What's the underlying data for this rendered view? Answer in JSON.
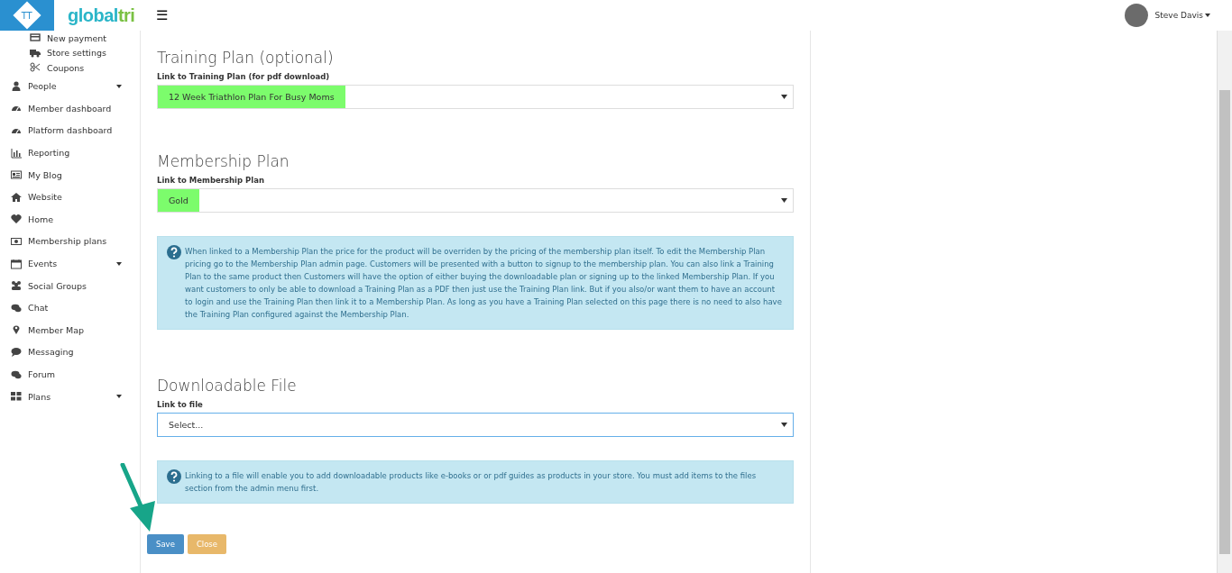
{
  "header": {
    "logo_mark": "TT",
    "logo_word": "global",
    "logo_word_accent": "tri",
    "menu_glyph": "☰",
    "user": {
      "name": "Steve Davis"
    }
  },
  "sidebar": {
    "sub_items": [
      {
        "label": "New payment"
      },
      {
        "label": "Store settings"
      },
      {
        "label": "Coupons"
      }
    ],
    "items": [
      {
        "label": "People",
        "has_submenu": true
      },
      {
        "label": "Member dashboard",
        "has_submenu": false
      },
      {
        "label": "Platform dashboard",
        "has_submenu": false
      },
      {
        "label": "Reporting",
        "has_submenu": false
      },
      {
        "label": "My Blog",
        "has_submenu": false
      },
      {
        "label": "Website",
        "has_submenu": false
      },
      {
        "label": "Home",
        "has_submenu": false
      },
      {
        "label": "Membership plans",
        "has_submenu": false
      },
      {
        "label": "Events",
        "has_submenu": true
      },
      {
        "label": "Social Groups",
        "has_submenu": false
      },
      {
        "label": "Chat",
        "has_submenu": false
      },
      {
        "label": "Member Map",
        "has_submenu": false
      },
      {
        "label": "Messaging",
        "has_submenu": false
      },
      {
        "label": "Forum",
        "has_submenu": false
      },
      {
        "label": "Plans",
        "has_submenu": true
      }
    ]
  },
  "sections": [
    {
      "title": "Training Plan (optional)",
      "label": "Link to Training Plan (for pdf download)",
      "value": "12 Week Triathlon Plan For Busy Moms",
      "highlighted": true,
      "focused": false
    },
    {
      "title": "Membership Plan",
      "label": "Link to Membership Plan",
      "value": "Gold",
      "highlighted": true,
      "focused": false,
      "note": "When linked to a Membership Plan the price for the product will be overriden by the pricing of the membership plan itself. To edit the Membership Plan pricing go to the Membership Plan admin page. Customers will be presented with a button to signup to the membership plan. You can also link a Training Plan to the same product then Customers will have the option of either buying the downloadable plan or signing up to the linked Membership Plan. If you want customers to only be able to download a Training Plan as a PDF then just use the Training Plan link. But if you also/or want them to have an account to login and use the Training Plan then link it to a Membership Plan. As long as you have a Training Plan selected on this page there is no need to also have the Training Plan configured against the Membership Plan."
    },
    {
      "title": "Downloadable File",
      "label": "Link to file",
      "value": "Select...",
      "highlighted": false,
      "focused": true,
      "note": "Linking to a file will enable you to add downloadable products like e-books or or pdf guides as products in your store. You must add items to the files section from the admin menu first."
    }
  ],
  "buttons": [
    {
      "label": "Save",
      "kind": "primary"
    },
    {
      "label": "Close",
      "kind": "warning"
    }
  ]
}
